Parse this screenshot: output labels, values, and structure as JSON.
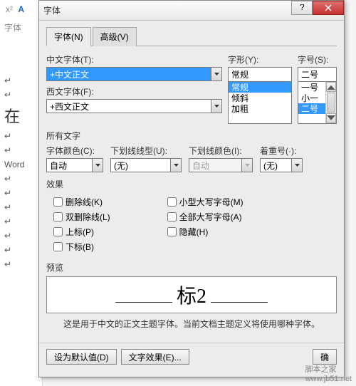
{
  "dialog": {
    "title": "字体",
    "help_icon": "help-icon",
    "close_icon": "close-icon"
  },
  "tabs": {
    "font": "字体(N)",
    "advanced": "高级(V)"
  },
  "labels": {
    "cn_font": "中文字体(T):",
    "west_font": "西文字体(F):",
    "style": "字形(Y):",
    "size": "字号(S):",
    "all_text": "所有文字",
    "font_color": "字体颜色(C):",
    "underline_style": "下划线线型(U):",
    "underline_color": "下划线颜色(I):",
    "emphasis": "着重号(·):",
    "effects": "效果",
    "preview": "预览"
  },
  "values": {
    "cn_font": "+中文正文",
    "west_font": "+西文正文",
    "style": "常规",
    "size": "二号",
    "font_color": "自动",
    "underline_style": "(无)",
    "underline_color": "自动",
    "emphasis": "(无)"
  },
  "style_list": [
    "常规",
    "倾斜",
    "加粗"
  ],
  "size_list": [
    "一号",
    "小一",
    "二号"
  ],
  "checks": {
    "strike": "删除线(K)",
    "dstrike": "双删除线(L)",
    "super": "上标(P)",
    "sub": "下标(B)",
    "smallcaps": "小型大写字母(M)",
    "allcaps": "全部大写字母(A)",
    "hidden": "隐藏(H)"
  },
  "preview_text": "标2",
  "note": "这是用于中文的正文主题字体。当前文档主题定义将使用哪种字体。",
  "buttons": {
    "default": "设为默认值(D)",
    "effects": "文字效果(E)...",
    "ok": "确"
  },
  "bg": {
    "x2": "x²",
    "a": "A",
    "font_lbl": "字体",
    "zai": "在",
    "word": "Word"
  },
  "watermark": "脚本之家\nwww.jb51.net"
}
